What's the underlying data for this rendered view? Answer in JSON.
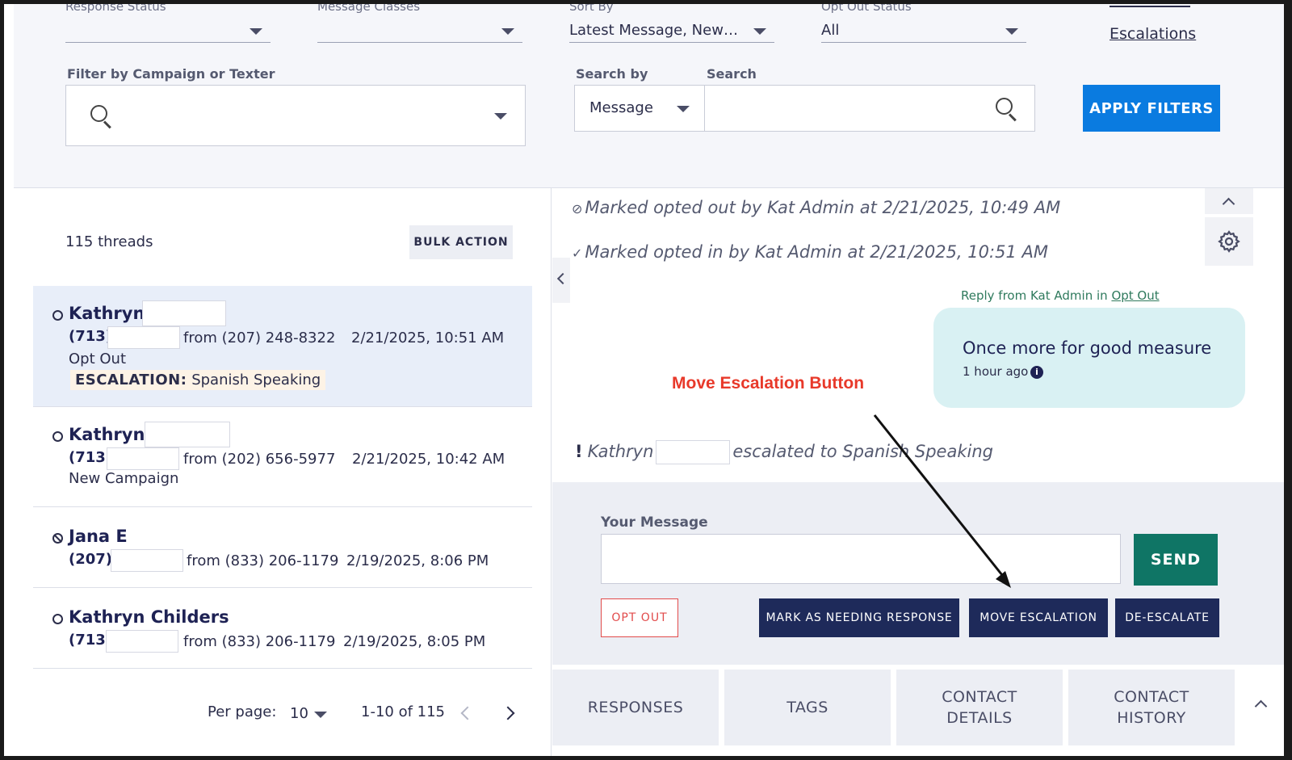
{
  "filters": {
    "response_status": {
      "label": "Response Status",
      "value": ""
    },
    "message_classes": {
      "label": "Message Classes",
      "value": ""
    },
    "sort_by": {
      "label": "Sort By",
      "value": "Latest Message, Newes..."
    },
    "opt_out_status": {
      "label": "Opt Out Status",
      "value": "All"
    },
    "escalations_link": "Escalations",
    "campaign_filter_label": "Filter by Campaign or Texter",
    "search_by_label": "Search by",
    "search_by_value": "Message",
    "search_label": "Search",
    "apply_label": "APPLY FILTERS"
  },
  "threads": {
    "count_label": "115 threads",
    "bulk_action_label": "BULK ACTION",
    "items": [
      {
        "name": "Kathryn",
        "area": "(713)",
        "from": "from (207) 248-8322",
        "date": "2/21/2025, 10:51 AM",
        "campaign": "Opt Out",
        "escalation_key": "ESCALATION:",
        "escalation_value": "Spanish Speaking"
      },
      {
        "name": "Kathryn",
        "area": "(713)",
        "from": "from (202) 656-5977",
        "date": "2/21/2025, 10:42 AM",
        "campaign": "New Campaign"
      },
      {
        "name": "Jana E",
        "area": "(207)",
        "from": "from (833) 206-1179",
        "date": "2/19/2025, 8:06 PM"
      },
      {
        "name": "Kathryn Childers",
        "area": "(713)",
        "from": "from (833) 206-1179",
        "date": "2/19/2025, 8:05 PM"
      }
    ],
    "pager": {
      "per_page_label": "Per page:",
      "per_page_value": "10",
      "range": "1-10 of 115"
    }
  },
  "conversation": {
    "event_opted_out": "Marked opted out by Kat Admin at 2/21/2025, 10:49 AM",
    "event_opted_in": "Marked opted in by Kat Admin at 2/21/2025, 10:51 AM",
    "reply_meta_prefix": "Reply from Kat Admin in",
    "reply_meta_link": "Opt Out",
    "bubble_text": "Once more for good measure",
    "bubble_time": "1 hour ago",
    "escalation_event_name": "Kathryn",
    "escalation_event_text": "escalated to Spanish Speaking",
    "annotation": "Move Escalation Button"
  },
  "composer": {
    "label": "Your Message",
    "send_label": "SEND",
    "opt_out_label": "OPT OUT",
    "mark_label": "MARK AS NEEDING RESPONSE",
    "move_escalation_label": "MOVE ESCALATION",
    "deescalate_label": "DE-ESCALATE"
  },
  "tabs": {
    "responses": "RESPONSES",
    "tags": "TAGS",
    "contact_details_line1": "CONTACT",
    "contact_details_line2": "DETAILS",
    "contact_history_line1": "CONTACT",
    "contact_history_line2": "HISTORY"
  },
  "colors": {
    "primary_blue": "#0a7be0",
    "send_green": "#0f7565",
    "navy": "#1e2a5a",
    "opt_out_red": "#e24b4b",
    "annotation_red": "#e8392a",
    "bubble": "#d9f1f3"
  }
}
